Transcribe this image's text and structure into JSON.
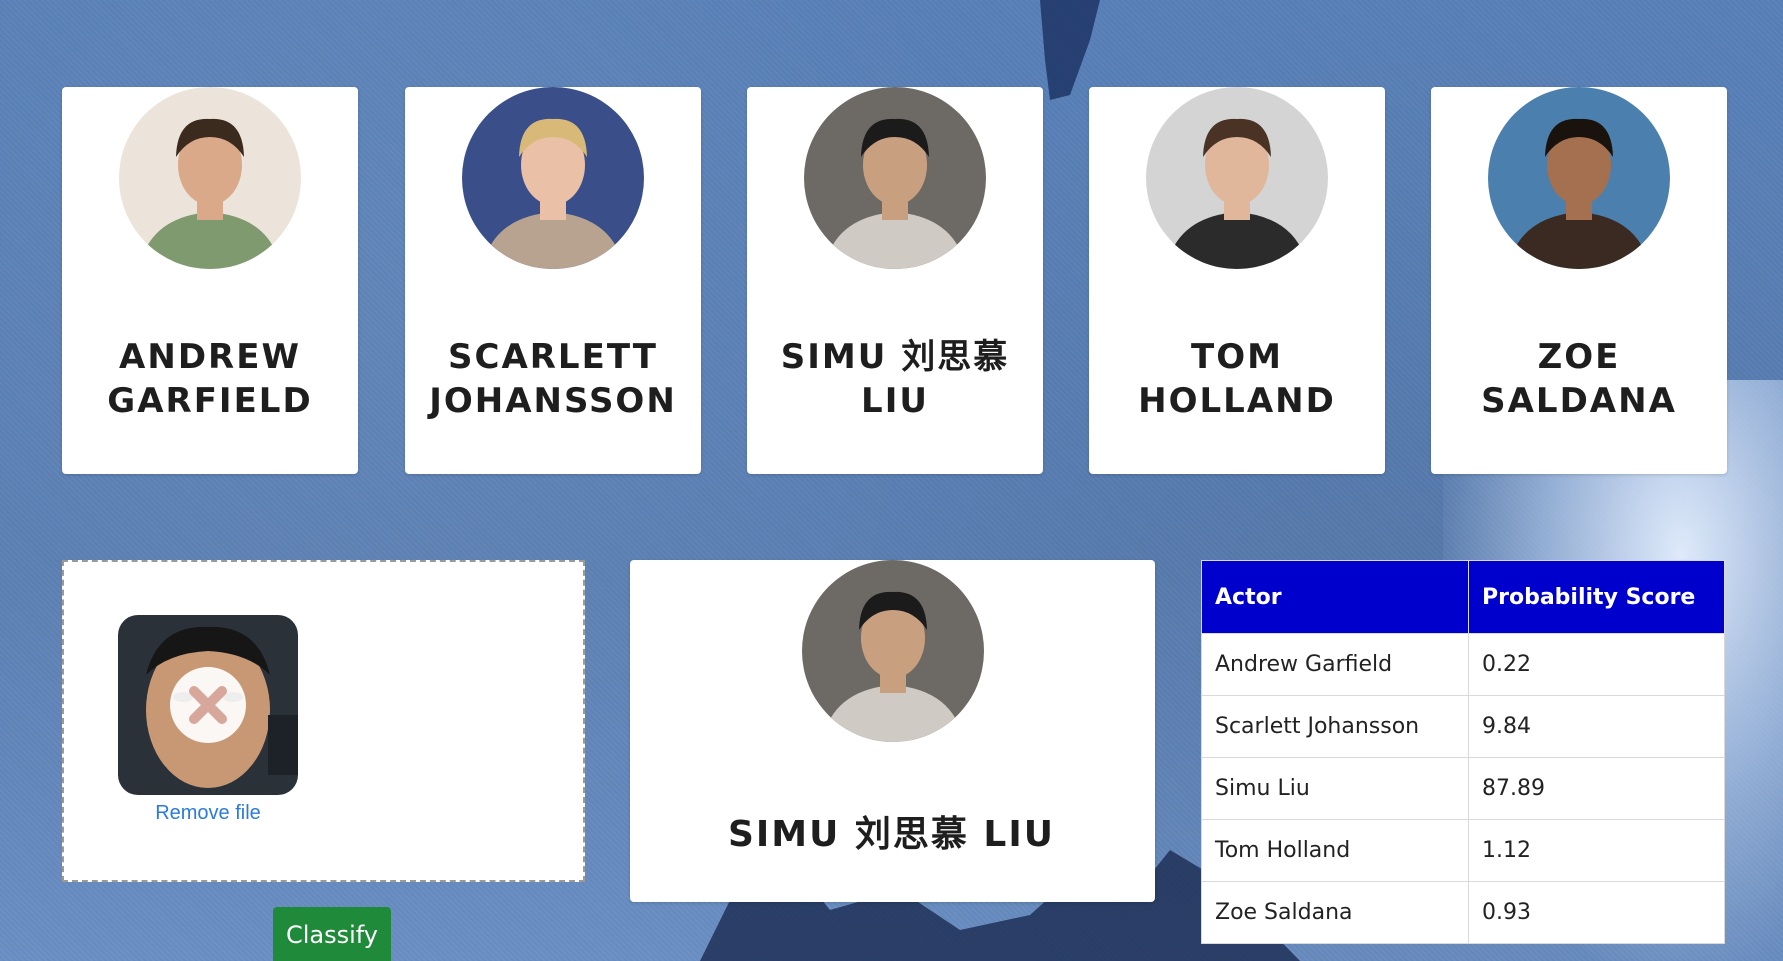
{
  "actors": [
    {
      "name": "ANDREW GARFIELD",
      "photo_icon": "andrew-garfield-photo",
      "skin": "#d9a98a",
      "bg": "#ece3da",
      "shirt": "#7f9a6e",
      "hair": "#3b2a1e"
    },
    {
      "name": "SCARLETT JOHANSSON",
      "photo_icon": "scarlett-johansson-photo",
      "skin": "#eac0a6",
      "bg": "#3a4f8a",
      "shirt": "#b7a38f",
      "hair": "#d9b978"
    },
    {
      "name": "SIMU 刘思慕 LIU",
      "photo_icon": "simu-liu-photo",
      "skin": "#c9a07f",
      "bg": "#6d6a66",
      "shirt": "#cfcac3",
      "hair": "#1b1b1b"
    },
    {
      "name": "TOM HOLLAND",
      "photo_icon": "tom-holland-photo",
      "skin": "#e1b79c",
      "bg": "#d4d4d4",
      "shirt": "#2b2b2b",
      "hair": "#4a3324"
    },
    {
      "name": "ZOE SALDANA",
      "photo_icon": "zoe-saldana-photo",
      "skin": "#a4704f",
      "bg": "#4a7fae",
      "shirt": "#3b2a22",
      "hair": "#1a120d"
    }
  ],
  "upload": {
    "remove_label": "Remove file",
    "thumb_icon": "uploaded-face-photo"
  },
  "result": {
    "name": "SIMU 刘思慕 LIU",
    "photo_icon": "simu-liu-photo"
  },
  "table": {
    "headers": [
      "Actor",
      "Probability Score"
    ],
    "rows": [
      {
        "actor": "Andrew Garfield",
        "score": "0.22"
      },
      {
        "actor": "Scarlett Johansson",
        "score": "9.84"
      },
      {
        "actor": "Simu Liu",
        "score": "87.89"
      },
      {
        "actor": "Tom Holland",
        "score": "1.12"
      },
      {
        "actor": "Zoe Saldana",
        "score": "0.93"
      }
    ]
  },
  "classify_label": "Classify",
  "colors": {
    "table_header": "#0000cc",
    "classify_button": "#1e8a3a",
    "link": "#2a7ae2",
    "background": "#5b7fb5"
  }
}
